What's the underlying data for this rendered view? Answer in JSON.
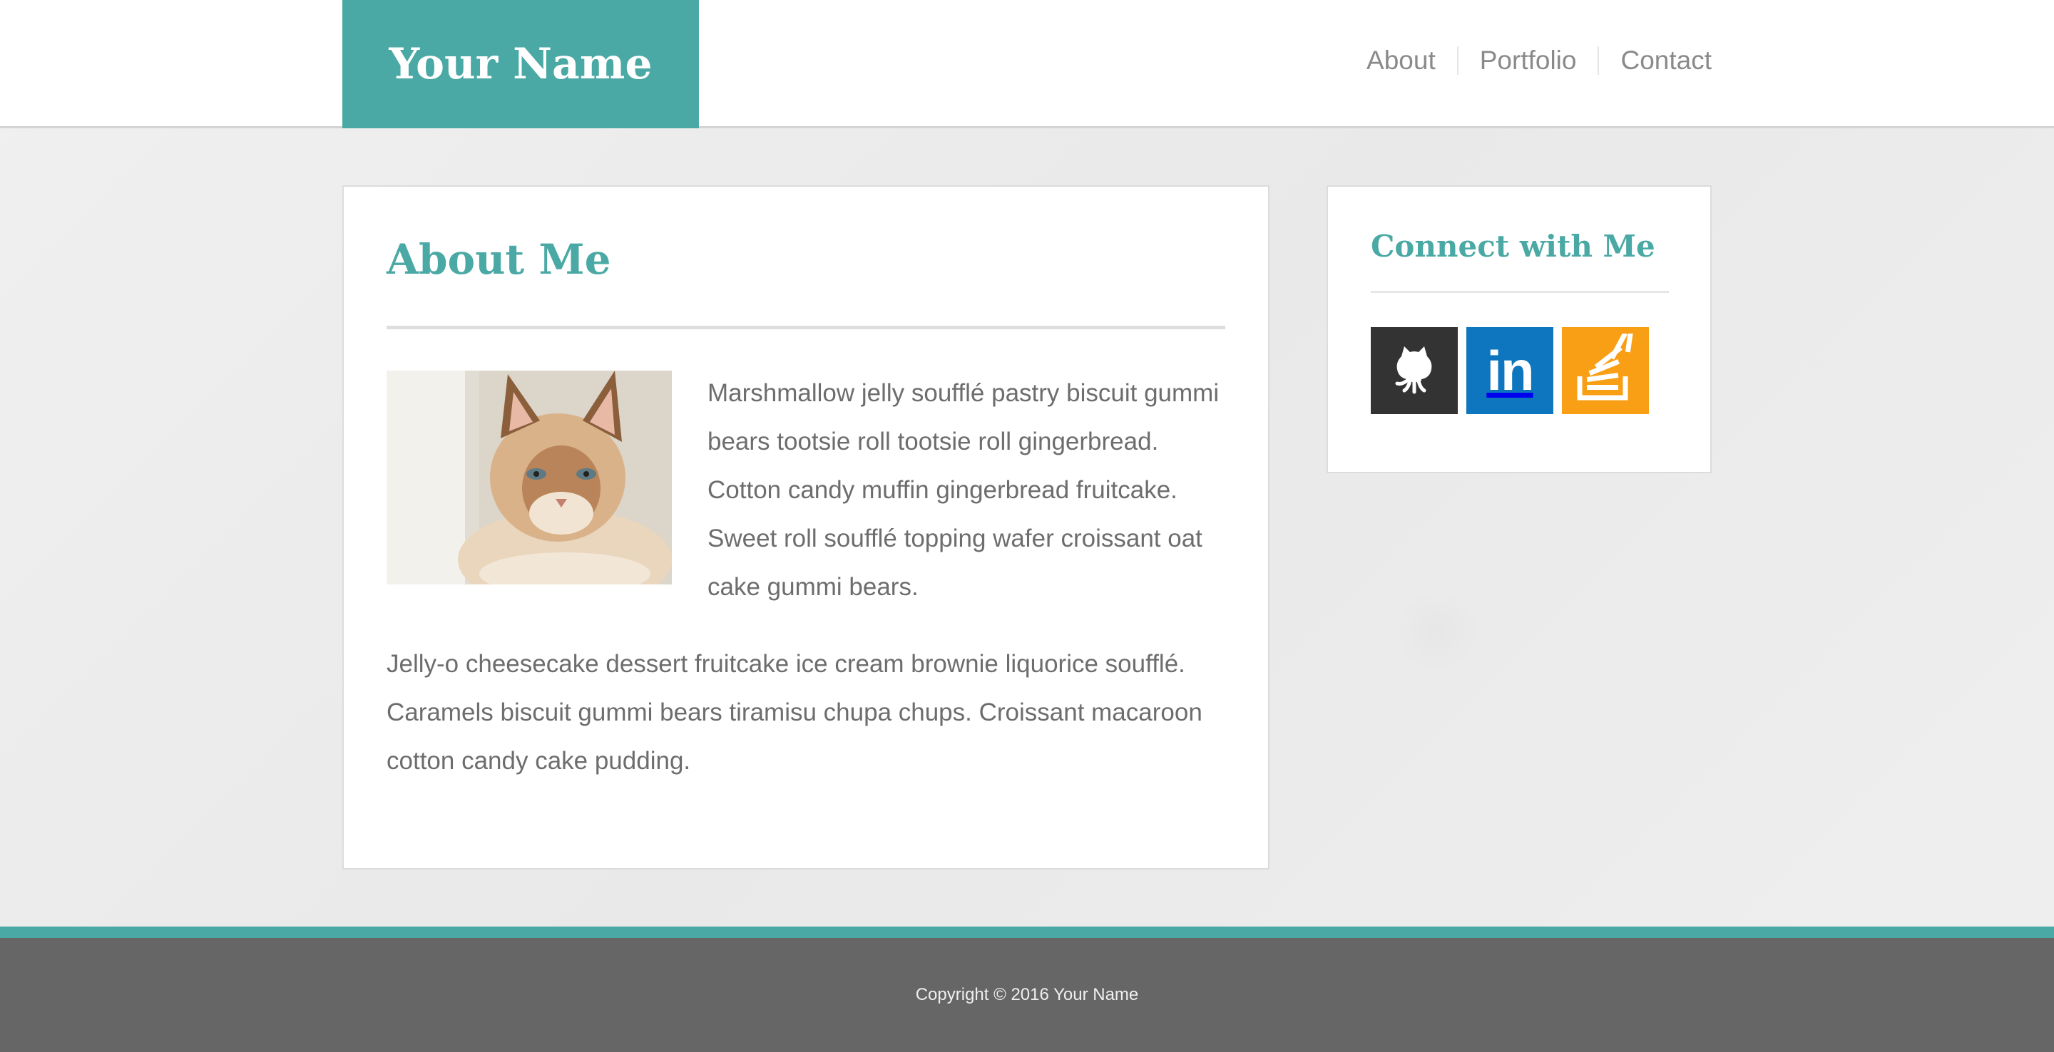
{
  "header": {
    "brand": "Your Name",
    "nav": [
      "About",
      "Portfolio",
      "Contact"
    ]
  },
  "main": {
    "title": "About Me",
    "paragraph1": "Marshmallow jelly soufflé pastry biscuit gummi bears tootsie roll tootsie roll gingerbread. Cotton candy muffin gingerbread fruitcake. Sweet roll soufflé topping wafer croissant oat cake gummi bears.",
    "paragraph2": "Jelly-o cheesecake dessert fruitcake ice cream brownie liquorice soufflé. Caramels biscuit gummi bears tiramisu chupa chups. Croissant macaroon cotton candy cake pudding.",
    "image": "cat-photo"
  },
  "sidebar": {
    "title": "Connect with Me",
    "social": [
      {
        "name": "github-icon",
        "color": "#333333"
      },
      {
        "name": "linkedin-icon",
        "label": "in",
        "color": "#0e76bf"
      },
      {
        "name": "stackoverflow-icon",
        "color": "#f99f15"
      }
    ]
  },
  "footer": {
    "copyright": "Copyright © 2016 Your Name"
  },
  "colors": {
    "accent": "#4aa9a4",
    "footer": "#666666",
    "text": "#6d6d6d"
  }
}
